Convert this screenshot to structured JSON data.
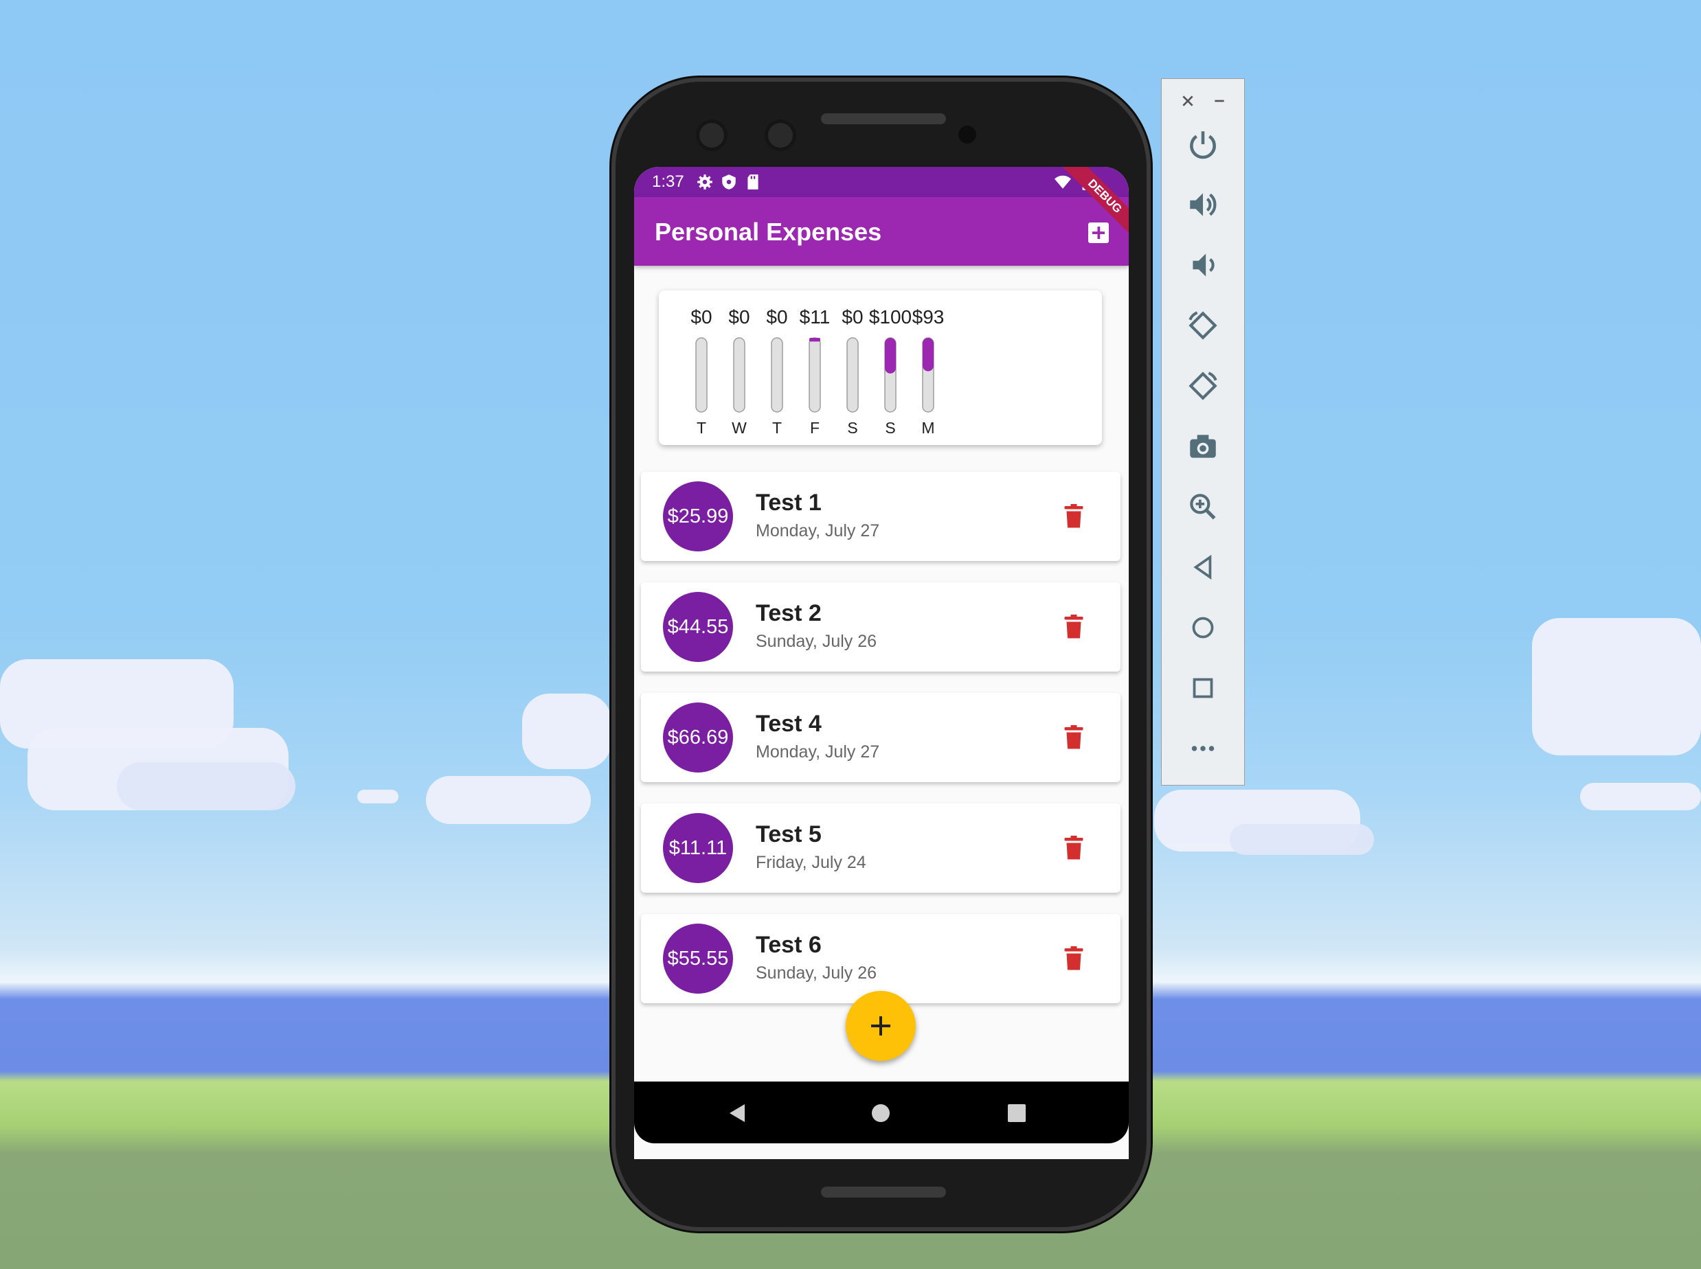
{
  "status_bar": {
    "time": "1:37"
  },
  "app_bar": {
    "title": "Personal Expenses",
    "debug_banner": "DEBUG"
  },
  "chart_data": {
    "type": "bar",
    "categories": [
      "T",
      "W",
      "T",
      "F",
      "S",
      "S",
      "M"
    ],
    "value_labels": [
      "$0",
      "$0",
      "$0",
      "$11",
      "$0",
      "$100",
      "$93"
    ],
    "values": [
      0,
      0,
      0,
      11,
      0,
      100,
      93
    ],
    "fill_fractions": [
      0,
      0,
      0,
      0.05,
      0,
      0.48,
      0.45
    ],
    "colors": {
      "fill": "#9c27b0",
      "track": "#e0e0e0"
    }
  },
  "transactions": [
    {
      "amount": "$25.99",
      "title": "Test 1",
      "date": "Monday, July 27"
    },
    {
      "amount": "$44.55",
      "title": "Test 2",
      "date": "Sunday, July 26"
    },
    {
      "amount": "$66.69",
      "title": "Test 4",
      "date": "Monday, July 27"
    },
    {
      "amount": "$11.11",
      "title": "Test 5",
      "date": "Friday, July 24"
    },
    {
      "amount": "$55.55",
      "title": "Test 6",
      "date": "Sunday, July 26"
    }
  ],
  "colors": {
    "primary": "#9c27b0",
    "primary_dark": "#7b1fa2",
    "accent": "#ffc107",
    "delete": "#d32f2f"
  },
  "emulator_panel": {
    "buttons": [
      "close-icon",
      "minimize-icon",
      "power-icon",
      "volume-up-icon",
      "volume-down-icon",
      "rotate-left-icon",
      "rotate-right-icon",
      "camera-icon",
      "zoom-icon",
      "back-icon",
      "home-icon",
      "overview-icon",
      "more-icon"
    ]
  }
}
